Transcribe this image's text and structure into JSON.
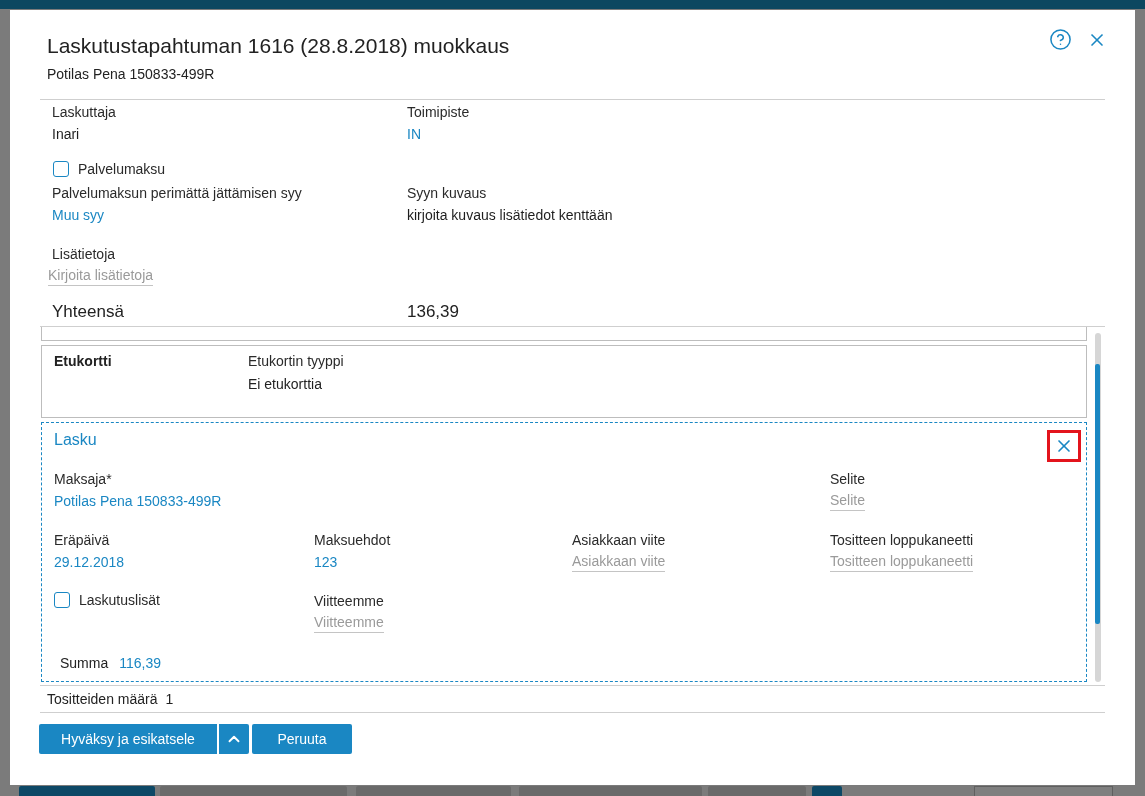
{
  "dialog": {
    "title": "Laskutustapahtuman 1616 (28.8.2018) muokkaus",
    "subtitle": "Potilas Pena 150833-499R",
    "details": [
      {
        "kind": "fields",
        "fields": [
          {
            "label": "Laskuttaja",
            "value": "Inari",
            "link": false
          },
          {
            "label": "Toimipiste",
            "value": "IN",
            "link": true
          }
        ]
      },
      {
        "kind": "checkbox",
        "label": "Palvelumaksu",
        "checked": false
      },
      {
        "kind": "fields",
        "fields": [
          {
            "label": "Palvelumaksun perimättä jättämisen syy",
            "value": "Muu syy",
            "link": true
          },
          {
            "label": "Syyn kuvaus",
            "value": "kirjoita kuvaus lisätiedot kenttään",
            "link": false
          }
        ]
      },
      {
        "kind": "textfield",
        "label": "Lisätietoja",
        "placeholder": "Kirjoita lisätietoja"
      }
    ],
    "total": {
      "label": "Yhteensä",
      "value": "136,39"
    },
    "benefit_card": {
      "title": "Etukortti",
      "label": "Etukortin tyyppi",
      "value": "Ei etukorttia"
    },
    "invoice_card": {
      "title": "Lasku",
      "close_highlighted": true,
      "rows": [
        {
          "cells": [
            {
              "kind": "value",
              "label": "Maksaja*",
              "value": "Potilas Pena 150833-499R",
              "link": true
            },
            "",
            "",
            {
              "kind": "placeholder",
              "label": "Selite",
              "placeholder": "Selite"
            }
          ]
        },
        {
          "cells": [
            {
              "kind": "value",
              "label": "Eräpäivä",
              "value": "29.12.2018",
              "link": true
            },
            {
              "kind": "value",
              "label": "Maksuehdot",
              "value": "123",
              "link": true
            },
            {
              "kind": "placeholder",
              "label": "Asiakkaan viite",
              "placeholder": "Asiakkaan viite"
            },
            {
              "kind": "placeholder",
              "label": "Tositteen loppukaneetti",
              "placeholder": "Tositteen loppukaneetti"
            }
          ]
        },
        {
          "cells": [
            {
              "kind": "checkbox",
              "label": "Laskutuslisät",
              "checked": false
            },
            {
              "kind": "placeholder",
              "label": "Viitteemme",
              "placeholder": "Viitteemme"
            }
          ]
        }
      ],
      "sum": {
        "label": "Summa",
        "value": "116,39"
      }
    },
    "footer": {
      "label": "Tositteiden määrä",
      "value": "1"
    },
    "actions": [
      {
        "kind": "split",
        "label": "Hyväksy ja esikatsele"
      },
      {
        "kind": "plain",
        "label": "Peruuta"
      }
    ]
  }
}
